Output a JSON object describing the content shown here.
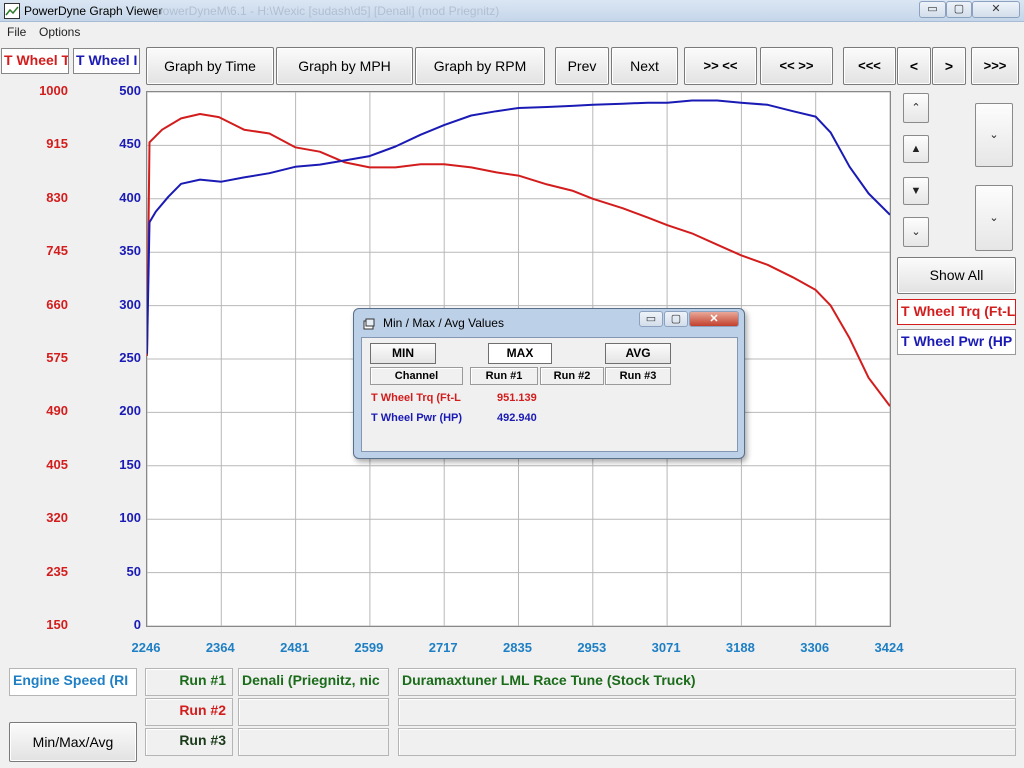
{
  "window": {
    "title": "PowerDyne Graph Viewer",
    "title_ghost": "powerDyneM\\6.1 - H:\\Wexic [sudash\\d5] [Denali] (mod Priegnitz)",
    "buttons": {
      "minimize": "▭",
      "maximize": "▢",
      "close": "✕"
    }
  },
  "menu": {
    "file": "File",
    "options": "Options"
  },
  "channel_tabs": {
    "torque": "T Wheel T",
    "power": "T Wheel I"
  },
  "toolbar": {
    "graph_by_time": "Graph by Time",
    "graph_by_mph": "Graph by MPH",
    "graph_by_rpm": "Graph by RPM",
    "prev": "Prev",
    "next": "Next",
    "zoom_in": ">> <<",
    "zoom_out": "<< >>",
    "scroll_far_left": "<<<",
    "scroll_left": "<",
    "scroll_right": ">",
    "scroll_far_right": ">>>"
  },
  "side": {
    "show_all": "Show All",
    "channel_torque": "T Wheel Trq (Ft-L",
    "channel_power": "T Wheel Pwr (HP"
  },
  "bottom": {
    "x_channel": "Engine Speed (RI",
    "min_max_avg": "Min/Max/Avg",
    "runs": [
      {
        "label": "Run #1",
        "vehicle": "Denali (Priegnitz, nic",
        "tune": "Duramaxtuner LML Race Tune (Stock Truck)"
      },
      {
        "label": "Run #2",
        "vehicle": "",
        "tune": ""
      },
      {
        "label": "Run #3",
        "vehicle": "",
        "tune": ""
      }
    ]
  },
  "dialog": {
    "title": "Min / Max / Avg Values",
    "min": "MIN",
    "max": "MAX",
    "avg": "AVG",
    "col_channel": "Channel",
    "col_run1": "Run #1",
    "col_run2": "Run #2",
    "col_run3": "Run #3",
    "rows": [
      {
        "channel": "T Wheel Trq (Ft-L",
        "run1": "951.139"
      },
      {
        "channel": "T Wheel Pwr (HP)",
        "run1": "492.940"
      }
    ]
  },
  "colors": {
    "torque": "#d31d1d",
    "power": "#1a1ab5",
    "x_axis": "#1e7fc4",
    "run1": "#1a6b1a",
    "run2": "#d31d1d",
    "run3": "#1a3a1a"
  },
  "chart_data": {
    "type": "line",
    "title": "",
    "xlabel": "Engine Speed (RI",
    "x_ticks": [
      "2246",
      "2364",
      "2481",
      "2599",
      "2717",
      "2835",
      "2953",
      "3071",
      "3188",
      "3306",
      "3424"
    ],
    "xlim": [
      2246,
      3424
    ],
    "y_left": {
      "label": "T Wheel T",
      "ticks": [
        "1000",
        "915",
        "830",
        "745",
        "660",
        "575",
        "490",
        "405",
        "320",
        "235",
        "150"
      ],
      "ylim": [
        150,
        1000
      ]
    },
    "y_right": {
      "label": "T Wheel I",
      "ticks": [
        "500",
        "450",
        "400",
        "350",
        "300",
        "250",
        "200",
        "150",
        "100",
        "50",
        "0"
      ],
      "ylim": [
        0,
        500
      ]
    },
    "grid": true,
    "series": [
      {
        "name": "T Wheel Trq (Ft-L",
        "axis": "left",
        "x": [
          2246,
          2250,
          2270,
          2300,
          2330,
          2360,
          2400,
          2440,
          2481,
          2520,
          2560,
          2599,
          2640,
          2680,
          2717,
          2760,
          2800,
          2835,
          2880,
          2920,
          2953,
          3000,
          3040,
          3071,
          3110,
          3150,
          3188,
          3230,
          3270,
          3306,
          3330,
          3360,
          3390,
          3424
        ],
        "y": [
          580,
          920,
          940,
          958,
          965,
          960,
          940,
          934,
          912,
          905,
          888,
          880,
          880,
          885,
          885,
          880,
          872,
          867,
          853,
          843,
          830,
          815,
          800,
          788,
          775,
          757,
          740,
          725,
          705,
          685,
          660,
          608,
          545,
          500
        ]
      },
      {
        "name": "T Wheel Pwr (HP)",
        "axis": "right",
        "x": [
          2246,
          2250,
          2260,
          2280,
          2300,
          2330,
          2364,
          2400,
          2440,
          2481,
          2520,
          2560,
          2599,
          2640,
          2680,
          2717,
          2760,
          2800,
          2835,
          2880,
          2920,
          2953,
          3000,
          3040,
          3071,
          3110,
          3150,
          3188,
          3230,
          3270,
          3306,
          3330,
          3360,
          3390,
          3424
        ],
        "y": [
          255,
          378,
          388,
          402,
          414,
          418,
          416,
          420,
          424,
          430,
          432,
          436,
          440,
          449,
          460,
          469,
          478,
          482,
          485,
          486,
          487,
          488,
          489,
          490,
          490,
          492,
          492,
          490,
          488,
          482,
          477,
          462,
          430,
          405,
          385
        ]
      }
    ]
  }
}
